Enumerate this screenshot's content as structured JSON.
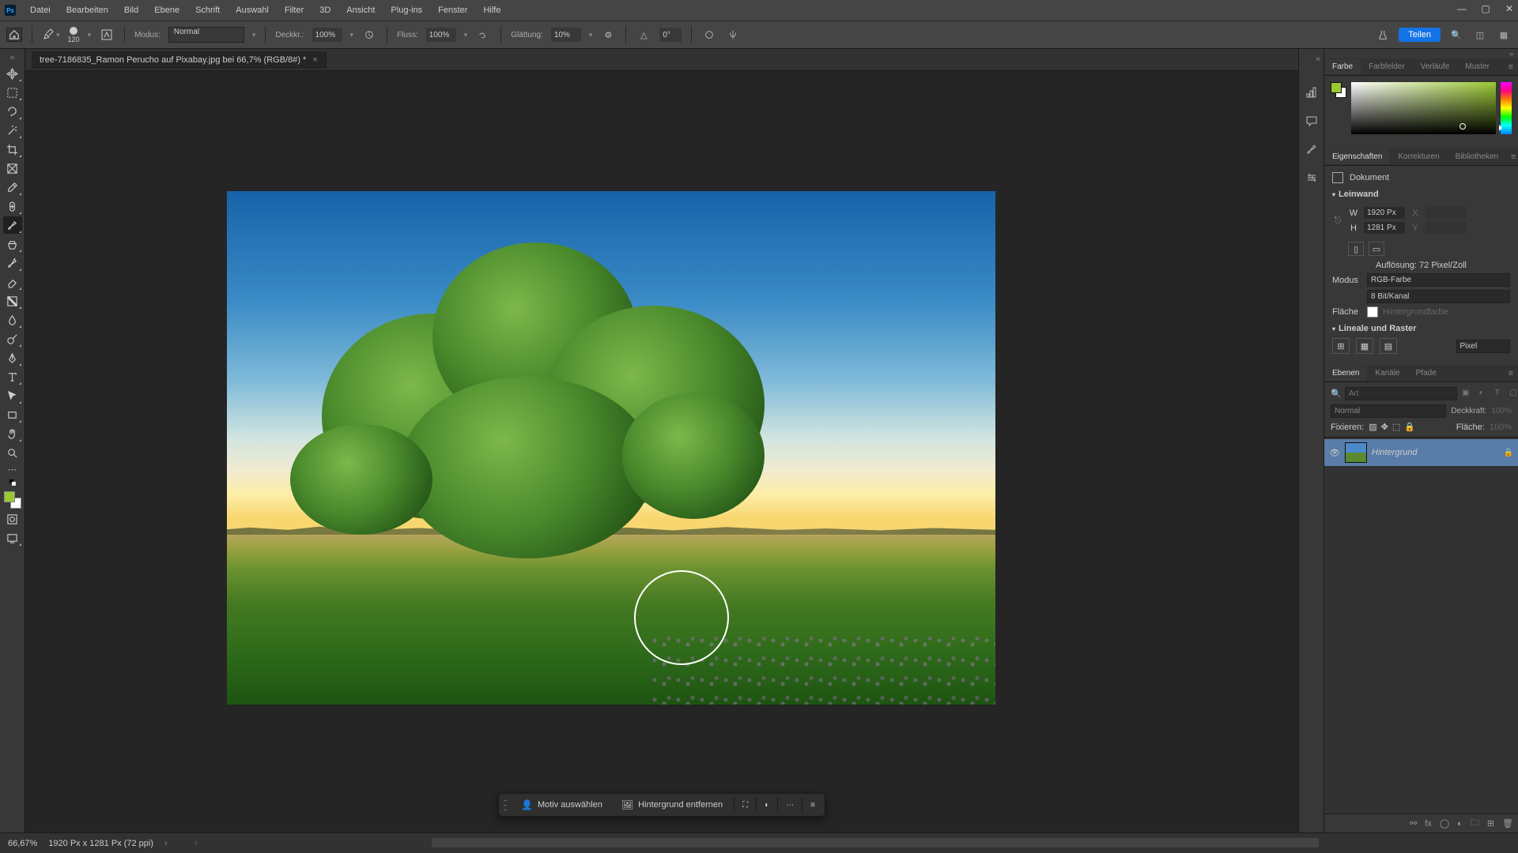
{
  "app": {
    "logo": "Ps"
  },
  "menu": {
    "items": [
      "Datei",
      "Bearbeiten",
      "Bild",
      "Ebene",
      "Schrift",
      "Auswahl",
      "Filter",
      "3D",
      "Ansicht",
      "Plug-ins",
      "Fenster",
      "Hilfe"
    ]
  },
  "options": {
    "brush_size": "120",
    "mode_label": "Modus:",
    "mode_value": "Normal",
    "opacity_label": "Deckkr.:",
    "opacity_value": "100%",
    "flow_label": "Fluss:",
    "flow_value": "100%",
    "smoothing_label": "Glättung:",
    "smoothing_value": "10%",
    "angle_value": "0°",
    "share": "Teilen"
  },
  "document": {
    "tab_title": "tree-7186835_Ramon Perucho auf Pixabay.jpg bei 66,7% (RGB/8#) *"
  },
  "context_bar": {
    "select_subject": "Motiv auswählen",
    "remove_bg": "Hintergrund entfernen"
  },
  "panels": {
    "color": {
      "tabs": [
        "Farbe",
        "Farbfelder",
        "Verläufe",
        "Muster"
      ]
    },
    "properties": {
      "tabs": [
        "Eigenschaften",
        "Korrekturen",
        "Bibliotheken"
      ],
      "doc_label": "Dokument",
      "canvas_section": "Leinwand",
      "width_label": "W",
      "width_value": "1920 Px",
      "x_label": "X",
      "height_label": "H",
      "height_value": "1281 Px",
      "y_label": "Y",
      "resolution": "Auflösung: 72 Pixel/Zoll",
      "mode_label": "Modus",
      "mode_value": "RGB-Farbe",
      "depth_value": "8 Bit/Kanal",
      "fill_label": "Fläche",
      "fill_value": "Hintergrundfarbe",
      "rulers_section": "Lineale und Raster",
      "rulers_unit": "Pixel"
    },
    "layers": {
      "tabs": [
        "Ebenen",
        "Kanäle",
        "Pfade"
      ],
      "search_placeholder": "Art",
      "blend_mode": "Normal",
      "opacity_label": "Deckkraft:",
      "opacity_value": "100%",
      "lock_label": "Fixieren:",
      "fill_label": "Fläche:",
      "fill_value": "100%",
      "bg_layer": "Hintergrund"
    }
  },
  "status": {
    "zoom": "66,67%",
    "doc_info": "1920 Px x 1281 Px (72 ppi)"
  }
}
